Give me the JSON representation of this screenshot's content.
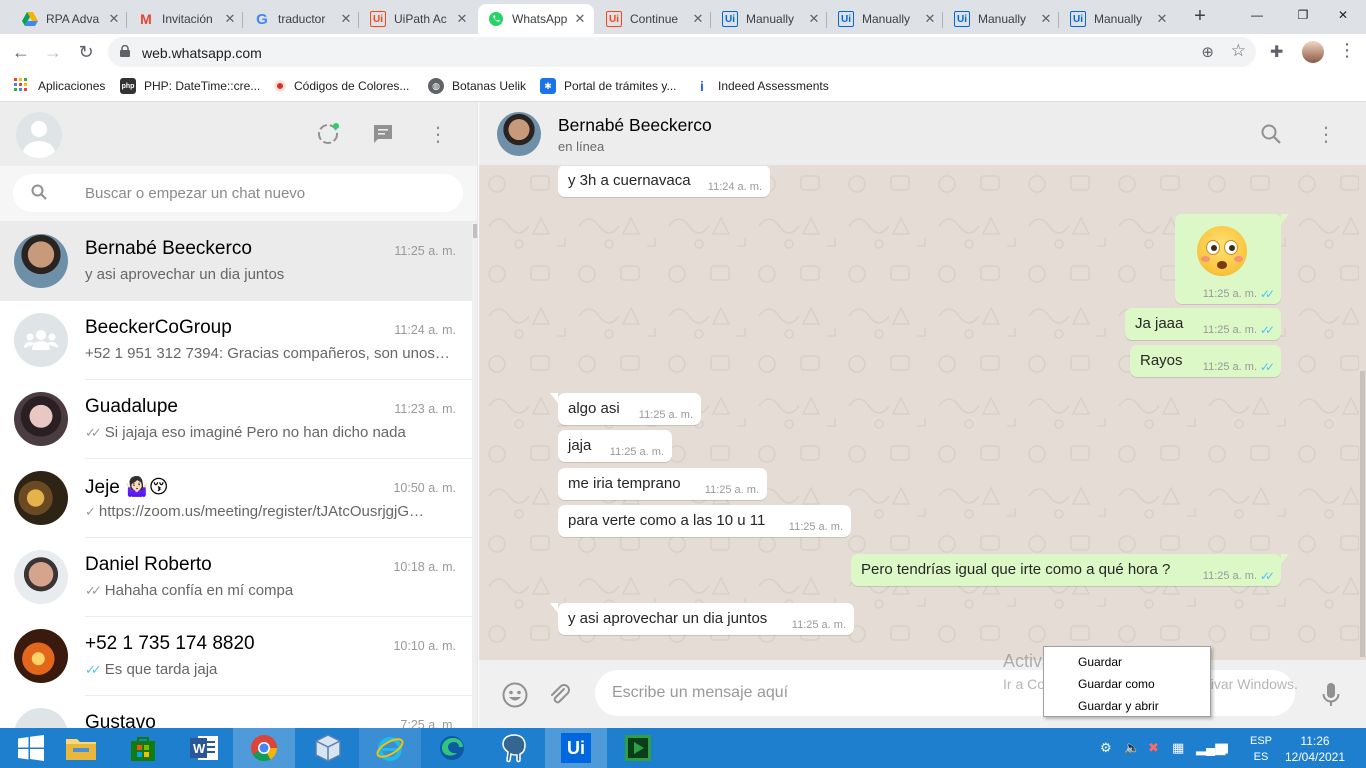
{
  "browser": {
    "tabs": [
      {
        "title": "RPA Adva",
        "icon": "google-drive-icon",
        "color": "#f4b400"
      },
      {
        "title": "Invitación",
        "icon": "gmail-icon",
        "color": "#ea4335"
      },
      {
        "title": "traductor",
        "icon": "google-icon",
        "color": "#4285f4"
      },
      {
        "title": "UiPath Ac",
        "icon": "uipath-icon",
        "color": "#fa4616"
      },
      {
        "title": "WhatsApp",
        "icon": "whatsapp-icon",
        "color": "#25d366"
      },
      {
        "title": "Continue",
        "icon": "uipath-icon",
        "color": "#fa4616"
      },
      {
        "title": "Manually",
        "icon": "uipath-icon",
        "color": "#0067df"
      },
      {
        "title": "Manually",
        "icon": "uipath-icon",
        "color": "#0067df"
      },
      {
        "title": "Manually",
        "icon": "uipath-icon",
        "color": "#0067df"
      },
      {
        "title": "Manually",
        "icon": "uipath-icon",
        "color": "#0067df"
      }
    ],
    "active_tab": 4,
    "url": "web.whatsapp.com",
    "bookmarks": [
      {
        "label": "Aplicaciones",
        "icon": "apps-grid-icon",
        "color": "#ea4335"
      },
      {
        "label": "PHP: DateTime::cre...",
        "icon": "php-icon",
        "color": "#333333"
      },
      {
        "label": "Códigos de Colores...",
        "icon": "color-dot-icon",
        "color": "#d93025"
      },
      {
        "label": "Botanas Uelik",
        "icon": "globe-icon",
        "color": "#5f6368"
      },
      {
        "label": "Portal de trámites y...",
        "icon": "portal-icon",
        "color": "#1a73e8"
      },
      {
        "label": "Indeed Assessments",
        "icon": "indeed-icon",
        "color": "#2164f3"
      }
    ]
  },
  "sidebar": {
    "search_placeholder": "Buscar o empezar un chat nuevo",
    "chats": [
      {
        "name": "Bernabé Beeckerco",
        "time": "11:25 a. m.",
        "preview": "y asi aprovechar un dia juntos",
        "ticks": "",
        "avatar": "photo-man"
      },
      {
        "name": "BeeckerCoGroup",
        "time": "11:24 a. m.",
        "preview": "+52 1 951 312 7394: Gracias compañeros, son unos…",
        "ticks": "",
        "avatar": "group-placeholder"
      },
      {
        "name": "Guadalupe",
        "time": "11:23 a. m.",
        "preview": "Si jajaja eso imaginé Pero no han dicho nada",
        "ticks": "grey-double",
        "avatar": "photo-woman"
      },
      {
        "name": "Jeje 🤷🏻‍♀️😚",
        "time": "10:50 a. m.",
        "preview": "https://zoom.us/meeting/register/tJAtcOusrjgjG…",
        "ticks": "grey-single",
        "avatar": "photo-food"
      },
      {
        "name": "Daniel Roberto",
        "time": "10:18 a. m.",
        "preview": "Hahaha confía en mí compa",
        "ticks": "grey-double",
        "avatar": "photo-man2"
      },
      {
        "name": "+52 1 735 174 8820",
        "time": "10:10 a. m.",
        "preview": "Es que tarda jaja",
        "ticks": "blue-double",
        "avatar": "photo-fire"
      },
      {
        "name": "Gustavo",
        "time": "7:25 a. m.",
        "preview": "",
        "ticks": "",
        "avatar": "placeholder"
      }
    ]
  },
  "conversation": {
    "contact_name": "Bernabé Beeckerco",
    "status": "en línea",
    "messages": [
      {
        "dir": "in",
        "text": "y 3h a cuernavaca",
        "time": "11:24 a. m."
      },
      {
        "dir": "out",
        "text": "",
        "emoji": "flushed-face-emoji",
        "time": "11:25 a. m."
      },
      {
        "dir": "out",
        "text": "Ja jaaa",
        "time": "11:25 a. m."
      },
      {
        "dir": "out",
        "text": "Rayos",
        "time": "11:25 a. m."
      },
      {
        "dir": "in",
        "text": "algo asi",
        "time": "11:25 a. m."
      },
      {
        "dir": "in",
        "text": "jaja",
        "time": "11:25 a. m."
      },
      {
        "dir": "in",
        "text": "me iria temprano",
        "time": "11:25 a. m."
      },
      {
        "dir": "in",
        "text": "para verte como a las 10 u 11",
        "time": "11:25 a. m."
      },
      {
        "dir": "out",
        "text": "Pero tendrías igual que irte como a qué hora ?",
        "time": "11:25 a. m."
      },
      {
        "dir": "in",
        "text": "y asi aprovechar un dia juntos",
        "time": "11:25 a. m."
      }
    ],
    "composer_placeholder": "Escribe un mensaje aquí"
  },
  "watermark": {
    "line1": "Activar Windows",
    "line2": "Ir a Configuración de PC para activar Windows."
  },
  "context_menu": [
    "Guardar",
    "Guardar como",
    "Guardar y abrir"
  ],
  "taskbar": {
    "apps": [
      "windows-start-icon",
      "file-explorer-icon",
      "store-icon",
      "word-icon",
      "chrome-icon",
      "virtualbox-icon",
      "internet-explorer-icon",
      "edge-icon",
      "postgres-icon",
      "uipath-studio-icon",
      "uipath-assistant-icon"
    ],
    "lang_line1": "ESP",
    "lang_line2": "ES",
    "time": "11:26",
    "date": "12/04/2021"
  },
  "colors": {
    "accent": "#25d366",
    "outgoing_bubble": "#dcf8c6",
    "chat_background": "#e5ddd5",
    "taskbar": "#1e7fcf",
    "read_ticks": "#4fc3f7"
  }
}
